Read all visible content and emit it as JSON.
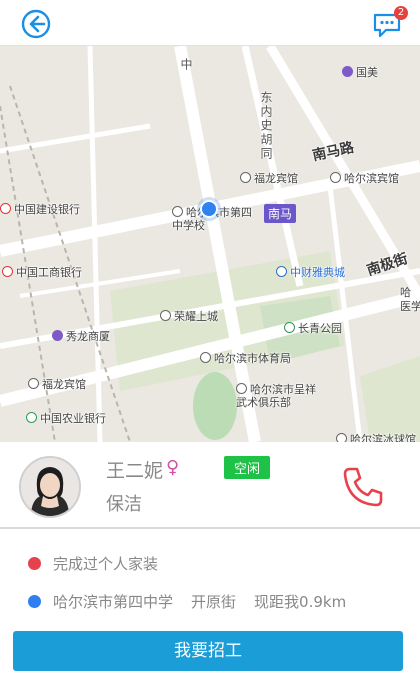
{
  "header": {
    "back_icon": "back-arrow-circle-icon",
    "message_icon": "chat-bubble-icon",
    "message_badge_count": "2",
    "accent_color": "#1a8fe3"
  },
  "map": {
    "road_labels": [
      "南马路",
      "东内史胡同",
      "南极街",
      "中"
    ],
    "poi_labels": {
      "guomei": "国美",
      "fulong_hotel_1": "福龙宾馆",
      "harbin_hotel": "哈尔滨宾馆",
      "ccb": "中国建设银行",
      "school": "哈尔滨市第四中学校",
      "nanma_station": "南马",
      "zhongcai": "中财雅典城",
      "icbc": "中国工商银行",
      "xiulong": "秀龙商厦",
      "rongyao": "荣耀上城",
      "changqing_park": "长青公园",
      "stadium": "哈尔滨市体育局",
      "fulong_hotel_2": "福龙宾馆",
      "wushu_club": "哈尔滨市呈祥武术俱乐部",
      "abc_bank": "中国农业银行",
      "ice_skating": "哈尔滨冰球馆",
      "medical": "医学",
      "ha": "哈"
    }
  },
  "profile": {
    "name": "王二妮",
    "gender_symbol": "♀",
    "status": "空闲",
    "job": "保洁",
    "status_color": "#1ec247",
    "phone_icon": "phone-icon"
  },
  "info": {
    "experience_label": "完成过个人家装",
    "location_name": "哈尔滨市第四中学",
    "street": "开原街",
    "distance": "现距我0.9km",
    "red_dot_color": "#e8414e",
    "blue_dot_color": "#2f7ff2"
  },
  "action": {
    "recruit_label": "我要招工",
    "button_color": "#1b9ed8"
  }
}
